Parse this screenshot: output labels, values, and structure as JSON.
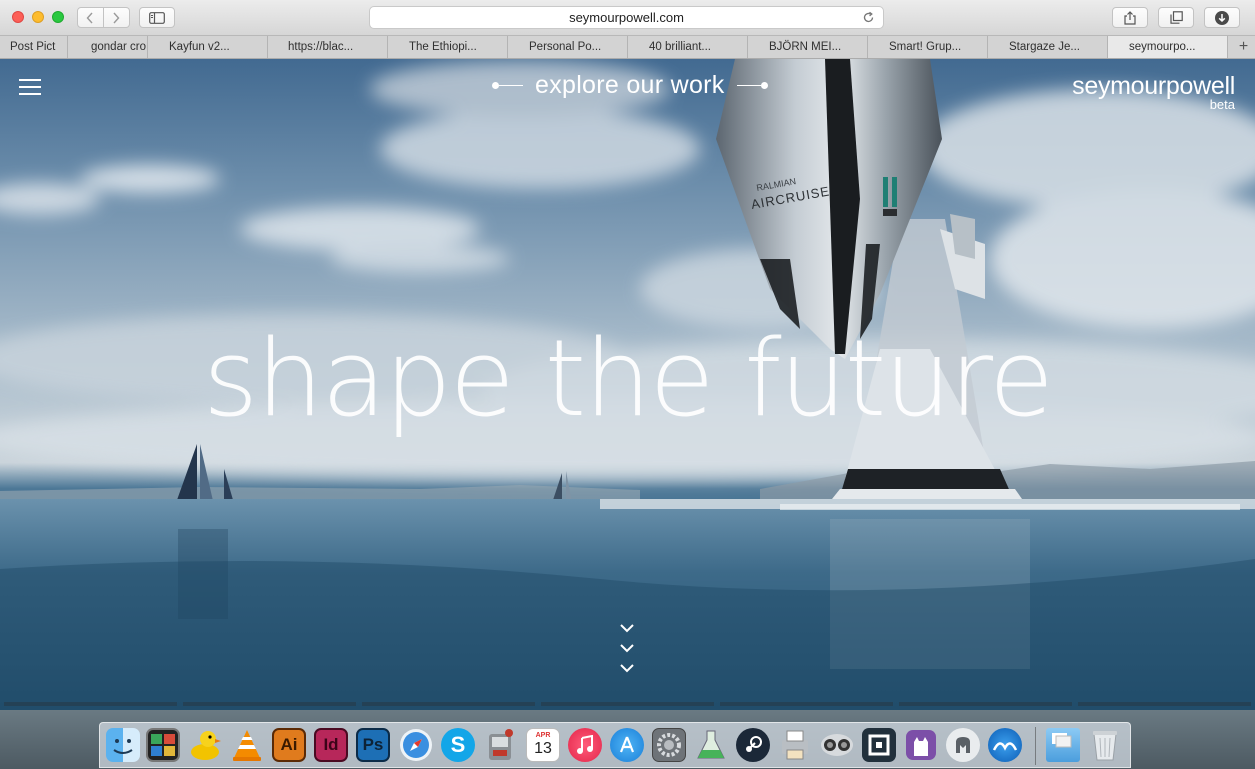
{
  "browser": {
    "url": "seymourpowell.com",
    "tabs": [
      {
        "label": "Post Pict"
      },
      {
        "label": "gondar cro"
      },
      {
        "label": "Kayfun v2..."
      },
      {
        "label": "https://blac..."
      },
      {
        "label": "The Ethiopi..."
      },
      {
        "label": "Personal Po..."
      },
      {
        "label": "40 brilliant..."
      },
      {
        "label": "BJÖRN MEI..."
      },
      {
        "label": "Smart! Grup..."
      },
      {
        "label": "Stargaze Je..."
      },
      {
        "label": "seymourpo...",
        "active": true
      }
    ],
    "new_tab": "+"
  },
  "page": {
    "nav_link": "explore our work",
    "brand": "seymourpowell",
    "brand_sub": "beta",
    "headline": "shape the future",
    "airship_brand": "RALMIAN",
    "airship_name": "AIRCRUISE"
  },
  "dock": {
    "calendar_month": "APR",
    "calendar_day": "13",
    "items": [
      {
        "icon": "finder-icon"
      },
      {
        "icon": "photo-booth-icon"
      },
      {
        "icon": "cyberduck-icon"
      },
      {
        "icon": "vlc-icon"
      },
      {
        "icon": "illustrator-icon",
        "label": "Ai"
      },
      {
        "icon": "indesign-icon",
        "label": "Id"
      },
      {
        "icon": "photoshop-icon",
        "label": "Ps"
      },
      {
        "icon": "safari-icon"
      },
      {
        "icon": "skype-icon",
        "label": "S"
      },
      {
        "icon": "automator-icon"
      },
      {
        "icon": "calendar-icon"
      },
      {
        "icon": "itunes-icon"
      },
      {
        "icon": "app-store-icon"
      },
      {
        "icon": "system-preferences-icon"
      },
      {
        "icon": "flask-app-icon"
      },
      {
        "icon": "steam-icon"
      },
      {
        "icon": "printer-app-icon"
      },
      {
        "icon": "camtwist-icon"
      },
      {
        "icon": "square-app-icon"
      },
      {
        "icon": "github-icon"
      },
      {
        "icon": "evernote-icon"
      },
      {
        "icon": "openoffice-icon"
      },
      {
        "icon": "downloads-folder-icon"
      },
      {
        "icon": "trash-icon"
      }
    ]
  },
  "colors": {
    "close": "#fc5f57",
    "minimize": "#fdbc2e",
    "maximize": "#2ac840",
    "illustrator": "#e07b1d",
    "indesign": "#b7275a",
    "photoshop": "#1d6fb5"
  }
}
